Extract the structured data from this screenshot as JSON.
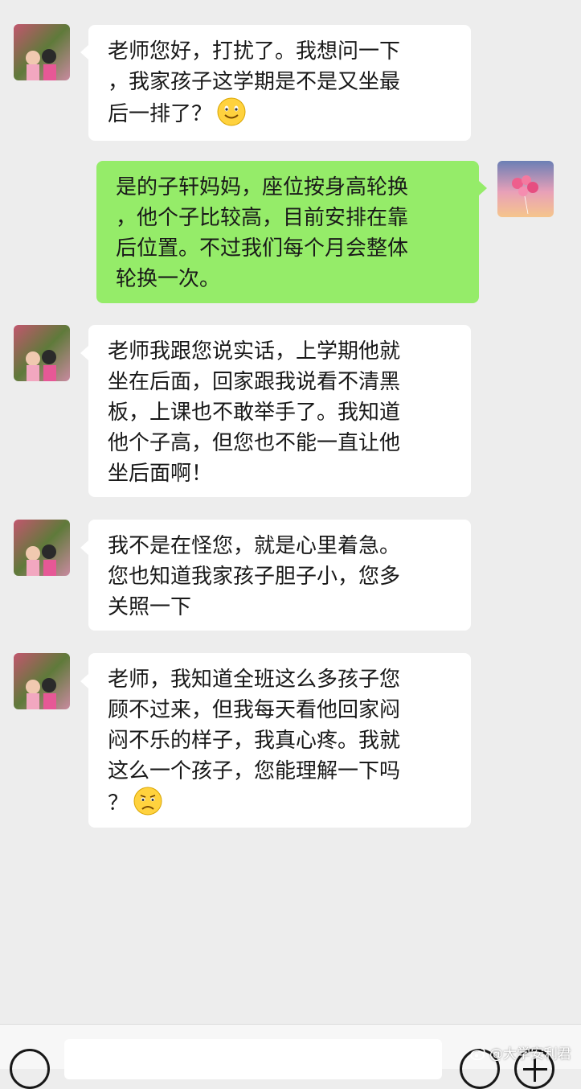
{
  "conversation": {
    "messages": [
      {
        "sender": "parent",
        "direction": "in",
        "lines": [
          "老师您好，打扰了。我想问一下",
          "，我家孩子这学期是不是又坐最",
          "后一排了？"
        ],
        "emoji": "smile-emoji"
      },
      {
        "sender": "teacher",
        "direction": "out",
        "lines": [
          "是的子轩妈妈，座位按身高轮换",
          "，他个子比较高，目前安排在靠",
          "后位置。不过我们每个月会整体",
          "轮换一次。"
        ]
      },
      {
        "sender": "parent",
        "direction": "in",
        "lines": [
          "老师我跟您说实话，上学期他就",
          "坐在后面，回家跟我说看不清黑",
          "板，上课也不敢举手了。我知道",
          "他个子高，但您也不能一直让他",
          "坐后面啊！"
        ]
      },
      {
        "sender": "parent",
        "direction": "in",
        "lines": [
          "我不是在怪您，就是心里着急。",
          "您也知道我家孩子胆子小，您多",
          "关照一下"
        ]
      },
      {
        "sender": "parent",
        "direction": "in",
        "lines": [
          "老师，我知道全班这么多孩子您",
          "顾不过来，但我每天看他回家闷",
          "闷不乐的样子，我真心疼。我就",
          "这么一个孩子，您能理解一下吗",
          "？"
        ],
        "emoji": "sad-emoji"
      }
    ]
  },
  "input_bar": {
    "voice_icon": "voice-icon",
    "emoji_icon": "emoji-icon",
    "plus_icon": "plus-icon"
  },
  "watermark": {
    "text": "@大学安利君",
    "icon": "weibo-icon"
  },
  "colors": {
    "background": "#ededed",
    "incoming_bubble": "#ffffff",
    "outgoing_bubble": "#95ec69",
    "text": "#191919"
  }
}
